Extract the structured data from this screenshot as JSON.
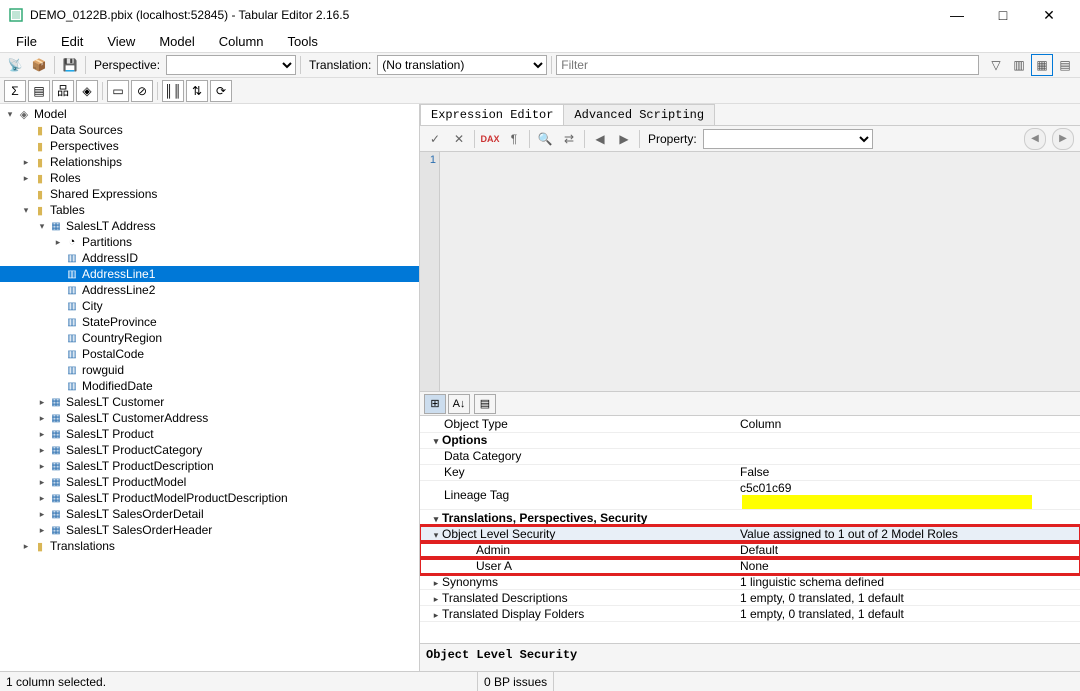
{
  "window": {
    "title": "DEMO_0122B.pbix (localhost:52845) - Tabular Editor 2.16.5"
  },
  "menu": {
    "file": "File",
    "edit": "Edit",
    "view": "View",
    "model": "Model",
    "column": "Column",
    "tools": "Tools"
  },
  "tb": {
    "persp_label": "Perspective:",
    "trans_label": "Translation:",
    "trans_value": "(No translation)",
    "filter_placeholder": "Filter",
    "property_label": "Property:"
  },
  "tree": {
    "root": "Model",
    "dataSources": "Data Sources",
    "perspectives": "Perspectives",
    "relationships": "Relationships",
    "roles": "Roles",
    "sharedExpr": "Shared Expressions",
    "tables": "Tables",
    "addr": "SalesLT Address",
    "partitions": "Partitions",
    "cols": [
      "AddressID",
      "AddressLine1",
      "AddressLine2",
      "City",
      "StateProvince",
      "CountryRegion",
      "PostalCode",
      "rowguid",
      "ModifiedDate"
    ],
    "others": [
      "SalesLT Customer",
      "SalesLT CustomerAddress",
      "SalesLT Product",
      "SalesLT ProductCategory",
      "SalesLT ProductDescription",
      "SalesLT ProductModel",
      "SalesLT ProductModelProductDescription",
      "SalesLT SalesOrderDetail",
      "SalesLT SalesOrderHeader"
    ],
    "translations": "Translations"
  },
  "tabs": {
    "expr": "Expression Editor",
    "adv": "Advanced Scripting"
  },
  "editor": {
    "gutter": "1"
  },
  "props": {
    "objectType_k": "Object Type",
    "objectType_v": "Column",
    "options": "Options",
    "dataCategory": "Data Category",
    "key_k": "Key",
    "key_v": "False",
    "lineage_k": "Lineage Tag",
    "lineage_v": "c5c01c69",
    "tps": "Translations, Perspectives, Security",
    "ols_k": "Object Level Security",
    "ols_v": "Value assigned to 1 out of 2 Model Roles",
    "admin_k": "Admin",
    "admin_v": "Default",
    "usera_k": "User A",
    "usera_v": "None",
    "syn_k": "Synonyms",
    "syn_v": "1 linguistic schema defined",
    "tdesc_k": "Translated Descriptions",
    "tdesc_v": "1 empty, 0 translated, 1 default",
    "tdf_k": "Translated Display Folders",
    "tdf_v": "1 empty, 0 translated, 1 default"
  },
  "propDesc": "Object Level Security",
  "status": {
    "left": "1 column selected.",
    "right": "0 BP issues"
  }
}
